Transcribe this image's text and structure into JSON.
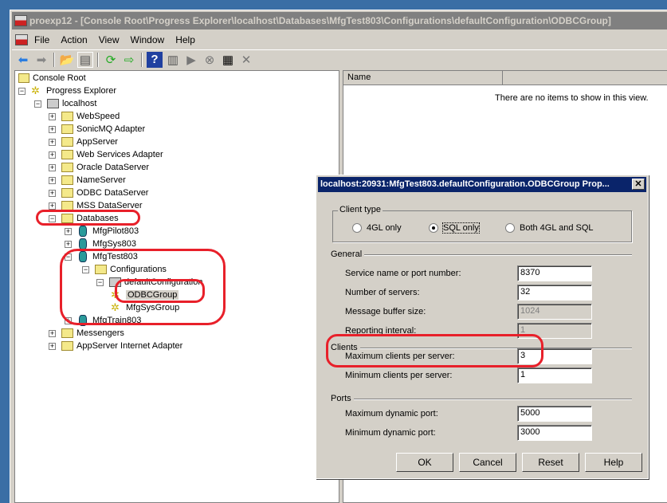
{
  "window": {
    "title": "proexp12 - [Console Root\\Progress Explorer\\localhost\\Databases\\MfgTest803\\Configurations\\defaultConfiguration\\ODBCGroup]"
  },
  "menu": [
    "File",
    "Action",
    "View",
    "Window",
    "Help"
  ],
  "toolbar": [
    "back-icon",
    "forward-icon",
    "up-folder-icon",
    "show-hide-tree-icon",
    "refresh-icon",
    "export-list-icon",
    "help-icon",
    "console-view-icon",
    "start-icon",
    "stop-icon",
    "properties-icon",
    "delete-icon"
  ],
  "tree": [
    {
      "label": "Console Root",
      "level": 0,
      "exp": "",
      "icon": "console"
    },
    {
      "label": "Progress Explorer",
      "level": 0,
      "exp": "-",
      "icon": "gear"
    },
    {
      "label": "localhost",
      "level": 1,
      "exp": "-",
      "icon": "comp"
    },
    {
      "label": "WebSpeed",
      "level": 2,
      "exp": "+",
      "icon": "folder"
    },
    {
      "label": "SonicMQ Adapter",
      "level": 2,
      "exp": "+",
      "icon": "folder"
    },
    {
      "label": "AppServer",
      "level": 2,
      "exp": "+",
      "icon": "folder"
    },
    {
      "label": "Web Services Adapter",
      "level": 2,
      "exp": "+",
      "icon": "folder"
    },
    {
      "label": "Oracle DataServer",
      "level": 2,
      "exp": "+",
      "icon": "folder"
    },
    {
      "label": "NameServer",
      "level": 2,
      "exp": "+",
      "icon": "folder"
    },
    {
      "label": "ODBC DataServer",
      "level": 2,
      "exp": "+",
      "icon": "folder"
    },
    {
      "label": "MSS DataServer",
      "level": 2,
      "exp": "+",
      "icon": "folder"
    },
    {
      "label": "Databases",
      "level": 2,
      "exp": "-",
      "icon": "folder"
    },
    {
      "label": "MfgPilot803",
      "level": 3,
      "exp": "+",
      "icon": "db"
    },
    {
      "label": "MfgSys803",
      "level": 3,
      "exp": "+",
      "icon": "db"
    },
    {
      "label": "MfgTest803",
      "level": 3,
      "exp": "-",
      "icon": "db"
    },
    {
      "label": "Configurations",
      "level": 4,
      "exp": "-",
      "icon": "folder"
    },
    {
      "label": "defaultConfiguration",
      "level": 5,
      "exp": "-",
      "icon": "comp"
    },
    {
      "label": "ODBCGroup",
      "level": 6,
      "exp": "",
      "icon": "gear",
      "selected": true
    },
    {
      "label": "MfgSysGroup",
      "level": 6,
      "exp": "",
      "icon": "gear"
    },
    {
      "label": "MfgTrain803",
      "level": 3,
      "exp": "+",
      "icon": "db"
    },
    {
      "label": "Messengers",
      "level": 2,
      "exp": "+",
      "icon": "folder"
    },
    {
      "label": "AppServer Internet Adapter",
      "level": 2,
      "exp": "+",
      "icon": "folder"
    }
  ],
  "list": {
    "column": "Name",
    "empty": "There are no items to show in this view."
  },
  "dialog": {
    "title": "localhost:20931:MfgTest803.defaultConfiguration.ODBCGroup Prop...",
    "client_type": {
      "label": "Client type",
      "options": [
        "4GL only",
        "SQL only",
        "Both 4GL and SQL"
      ],
      "selected": 1
    },
    "general": {
      "label": "General",
      "fields": [
        {
          "label": "Service name or port number:",
          "value": "8370",
          "disabled": false
        },
        {
          "label": "Number of servers:",
          "value": "32",
          "disabled": false
        },
        {
          "label": "Message buffer size:",
          "value": "1024",
          "disabled": true
        },
        {
          "label": "Reporting interval:",
          "value": "1",
          "disabled": true
        }
      ]
    },
    "clients": {
      "label": "Clients",
      "fields": [
        {
          "label": "Maximum clients per server:",
          "value": "3",
          "disabled": false
        },
        {
          "label": "Minimum clients per server:",
          "value": "1",
          "disabled": false
        }
      ]
    },
    "ports": {
      "label": "Ports",
      "fields": [
        {
          "label": "Maximum dynamic port:",
          "value": "5000",
          "disabled": false
        },
        {
          "label": "Minimum dynamic port:",
          "value": "3000",
          "disabled": false
        }
      ]
    },
    "buttons": [
      "OK",
      "Cancel",
      "Reset",
      "Help"
    ]
  },
  "colors": {
    "annotation": "#e8202a",
    "dialog_title": "#0a246a",
    "desktop": "#3a6ea5"
  }
}
